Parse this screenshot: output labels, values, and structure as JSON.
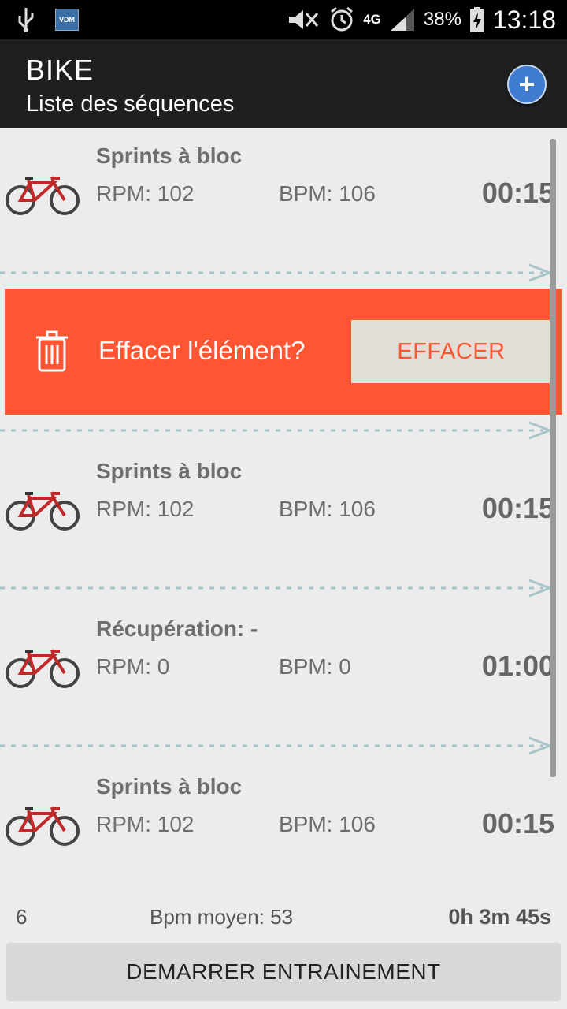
{
  "status_bar": {
    "icons": [
      "usb-icon",
      "vdm-icon",
      "mute-icon",
      "alarm-icon",
      "4g-icon",
      "signal-icon",
      "battery-icon"
    ],
    "vdm_label": "VDM",
    "network": "4G",
    "battery": "38%",
    "time": "13:18"
  },
  "app_bar": {
    "title": "BIKE",
    "subtitle": "Liste des séquences",
    "add_label": "+"
  },
  "delete_prompt": {
    "question": "Effacer l'élément?",
    "button": "EFFACER"
  },
  "items": [
    {
      "name": "Sprints à bloc",
      "rpm": "RPM: 102",
      "bpm": "BPM: 106",
      "duration": "00:15"
    },
    {
      "name": "Sprints à bloc",
      "rpm": "RPM: 102",
      "bpm": "BPM: 106",
      "duration": "00:15"
    },
    {
      "name": "Récupération: -",
      "rpm": "RPM: 0",
      "bpm": "BPM: 0",
      "duration": "01:00"
    },
    {
      "name": "Sprints à bloc",
      "rpm": "RPM: 102",
      "bpm": "BPM: 106",
      "duration": "00:15"
    }
  ],
  "footer": {
    "count": "6",
    "avg_bpm": "Bpm moyen: 53",
    "total": "0h 3m 45s",
    "start_button": "DEMARRER ENTRAINEMENT"
  },
  "colors": {
    "delete_bg": "#ff5533",
    "app_bar": "#1f1f1f",
    "add_button": "#3f7bd0",
    "divider": "#a8c4c8"
  }
}
